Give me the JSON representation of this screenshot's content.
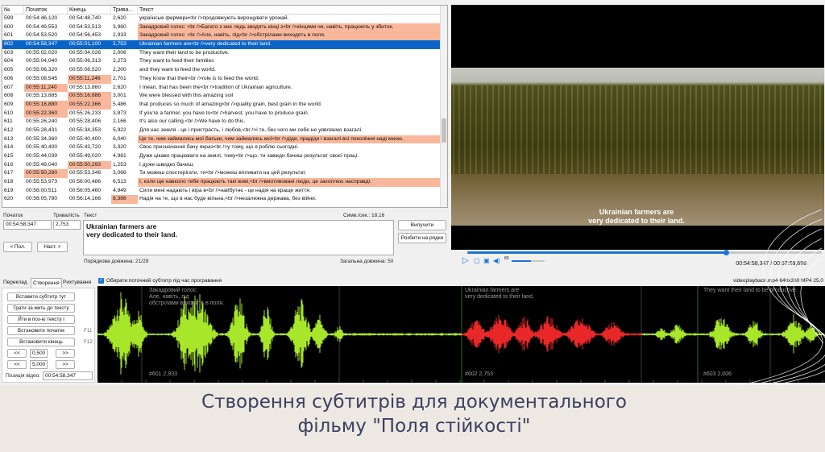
{
  "grid": {
    "headers": [
      "№",
      "Початок",
      "Кінець",
      "Трива...",
      "Текст"
    ],
    "rows": [
      {
        "n": "599",
        "start": "00:54:46,120",
        "end": "00:54:48,740",
        "dur": "2,620",
        "text": "українські фермери<br />продовжують вирощувати урожай.",
        "warn": false,
        "end_hl": false,
        "start_hl": false,
        "dur_hl": false,
        "sel": false
      },
      {
        "n": "600",
        "start": "00:54:49,553",
        "end": "00:54:53,513",
        "dur": "3,960",
        "text": "Закадровий голос: <br />Багато з них ледь зводять кінці з<br />кінцями чи, навіть, працюють у збиток.",
        "warn": true,
        "end_hl": false,
        "start_hl": false,
        "dur_hl": false,
        "sel": false
      },
      {
        "n": "601",
        "start": "00:54:53,520",
        "end": "00:54:56,453",
        "dur": "2,933",
        "text": "Закадровий голос: <br />Але, навіть, під<br />обстрілами виходять в поля.",
        "warn": true,
        "end_hl": false,
        "start_hl": false,
        "dur_hl": false,
        "sel": false
      },
      {
        "n": "602",
        "start": "00:54:58,347",
        "end": "00:55:01,100",
        "dur": "2,753",
        "text": "Ukrainian farmers are<br />very dedicated to their land.",
        "warn": false,
        "end_hl": false,
        "start_hl": false,
        "dur_hl": false,
        "sel": true
      },
      {
        "n": "603",
        "start": "00:55:02,020",
        "end": "00:55:04,026",
        "dur": "2,006",
        "text": "They want their land to be productive.",
        "warn": false,
        "end_hl": false,
        "start_hl": false,
        "dur_hl": false,
        "sel": false
      },
      {
        "n": "604",
        "start": "00:55:04,040",
        "end": "00:55:06,313",
        "dur": "2,273",
        "text": "They want to feed their families",
        "warn": false,
        "end_hl": false,
        "start_hl": false,
        "dur_hl": false,
        "sel": false
      },
      {
        "n": "605",
        "start": "00:55:06,320",
        "end": "00:55:08,520",
        "dur": "2,200",
        "text": "and they want to feed the world.",
        "warn": false,
        "end_hl": false,
        "start_hl": false,
        "dur_hl": false,
        "sel": false
      },
      {
        "n": "606",
        "start": "00:55:08,545",
        "end": "00:55:11,246",
        "dur": "2,701",
        "text": "They know that their<br />role is to feed the world.",
        "warn": false,
        "end_hl": true,
        "start_hl": false,
        "dur_hl": false,
        "sel": false
      },
      {
        "n": "607",
        "start": "00:55:11,240",
        "end": "00:55:13,860",
        "dur": "2,620",
        "text": "I mean, that has been the<br />tradition of Ukrainian agriculture.",
        "warn": false,
        "end_hl": false,
        "start_hl": true,
        "dur_hl": false,
        "sel": false
      },
      {
        "n": "608",
        "start": "00:55:13,885",
        "end": "00:55:16,886",
        "dur": "3,001",
        "text": "We were blessed with this amazing soil",
        "warn": false,
        "end_hl": true,
        "start_hl": false,
        "dur_hl": false,
        "sel": false
      },
      {
        "n": "609",
        "start": "00:55:16,880",
        "end": "00:55:22,366",
        "dur": "5,486",
        "text": "that produces so much of amazing<br />quality grain, best grain in the world.",
        "warn": false,
        "end_hl": true,
        "start_hl": true,
        "dur_hl": false,
        "sel": false
      },
      {
        "n": "610",
        "start": "00:55:22,360",
        "end": "00:55:26,233",
        "dur": "3,873",
        "text": "If you're a farmer, you have to<br />harvest, you have to produce grain.",
        "warn": false,
        "end_hl": false,
        "start_hl": true,
        "dur_hl": false,
        "sel": false
      },
      {
        "n": "611",
        "start": "00:55:26,240",
        "end": "00:55:28,406",
        "dur": "2,166",
        "text": "It's also our calling.<br />We have to do this.",
        "warn": false,
        "end_hl": false,
        "start_hl": false,
        "dur_hl": false,
        "sel": false
      },
      {
        "n": "612",
        "start": "00:55:28,431",
        "end": "00:55:34,353",
        "dur": "5,922",
        "text": "Для нас земля - це і пристрасть, і любов,<br />і те, без чого ми себе не уявляємо взагалі.",
        "warn": false,
        "end_hl": false,
        "start_hl": false,
        "dur_hl": false,
        "sel": false
      },
      {
        "n": "613",
        "start": "00:55:34,360",
        "end": "00:55:40,400",
        "dur": "6,040",
        "text": "Це те, чим займались мої батьки, чим займались мої<br />діди, прадіди і взагалі всі покоління наді мною.",
        "warn": true,
        "end_hl": false,
        "start_hl": false,
        "dur_hl": false,
        "sel": false
      },
      {
        "n": "614",
        "start": "00:55:40,400",
        "end": "00:55:43,720",
        "dur": "3,320",
        "text": "Своє призначення бачу якраз<br />у тому, що я роблю сьогодні.",
        "warn": false,
        "end_hl": false,
        "start_hl": false,
        "dur_hl": false,
        "sel": false
      },
      {
        "n": "615",
        "start": "00:55:44,039",
        "end": "00:55:49,020",
        "dur": "4,981",
        "text": "Дуже цікаво працювати на землі, тому<br />що, ти завжди бачиш результат своєї праці.",
        "warn": false,
        "end_hl": false,
        "start_hl": false,
        "dur_hl": false,
        "sel": false
      },
      {
        "n": "616",
        "start": "00:55:49,040",
        "end": "00:55:50,293",
        "dur": "1,253",
        "text": "І дуже швидко бачиш.",
        "warn": false,
        "end_hl": true,
        "start_hl": false,
        "dur_hl": false,
        "sel": false
      },
      {
        "n": "617",
        "start": "00:55:50,280",
        "end": "00:55:53,346",
        "dur": "3,066",
        "text": "Ти можеш спостерігати, ти<br />можеш впливати на цей результат.",
        "warn": false,
        "end_hl": false,
        "start_hl": true,
        "dur_hl": false,
        "sel": false
      },
      {
        "n": "618",
        "start": "00:55:53,973",
        "end": "00:56:00,486",
        "dur": "6,513",
        "text": "І, коли ще навколо тебе працюють такі живі,<br />вмотивовані люди, це захоплює насправді.",
        "warn": true,
        "end_hl": false,
        "start_hl": false,
        "dur_hl": false,
        "sel": false
      },
      {
        "n": "619",
        "start": "00:56:00,511",
        "end": "00:56:05,460",
        "dur": "4,949",
        "text": "Сили мені надають і віра в<br />найбутнє - це надія на краще життя.",
        "warn": false,
        "end_hl": false,
        "start_hl": false,
        "dur_hl": false,
        "sel": false
      },
      {
        "n": "620",
        "start": "00:56:05,780",
        "end": "00:56:14,166",
        "dur": "8,386",
        "text": "Надія на те, що в нас буде вільна,<br />незалежна держава, без війни.",
        "warn": false,
        "end_hl": false,
        "start_hl": false,
        "dur_hl": true,
        "sel": false
      }
    ]
  },
  "editor": {
    "start_label": "Початок",
    "duration_label": "Тривалість",
    "text_label": "Текст",
    "cps_label": "Симв./сек.: 18,16",
    "start_value": "00:54:58,347",
    "duration_value": "2,753",
    "text_line1": "Ukrainian farmers are",
    "text_line2": "very dedicated to their land.",
    "prev_button": "< Пол.",
    "next_button": "Наст. >",
    "unbreak_button": "Вилучити",
    "split_button": "Розбити на рядки",
    "line_lengths": "Порядкова довжина: 21/29",
    "total_length": "Загальна довжина: 50"
  },
  "video": {
    "subtitle_line1": "Ukrainian farmers are",
    "subtitle_line2": "very dedicated to their land.",
    "volume_label": "80",
    "timecode": "00:54:58,347 / 00:57:59,696",
    "progress": 0.73
  },
  "tabs": [
    "Переклад",
    "Створення",
    "Рихтування"
  ],
  "create_panel": {
    "insert_button": "Вставити субтитр тут",
    "play_second_button": "Грати за мить до тексту",
    "go_to_button": "Йти в поз-ю тексту і",
    "set_start_button": "Встановити початок",
    "set_start_key": "F11",
    "set_end_button": "Встановити кінець",
    "set_end_key": "F12",
    "step1": "0,500",
    "step2": "5,000",
    "back": "<<",
    "forward": ">>",
    "video_pos_label": "Позиція відео:",
    "video_pos_value": "00:54:58,347"
  },
  "waveform": {
    "checkbox_label": "Обирати поточний субтитр під час програвання",
    "file_info": "videoplayback.mp4 640x360 MP4 25,0",
    "seg_left_text_1": "Закадровий голос:",
    "seg_left_text_2": "Але, навіть, під",
    "seg_left_text_3": "обстрілами виходять в поля.",
    "seg_mid_text_1": "Ukrainian farmers are",
    "seg_mid_text_2": "very dedicated to their land.",
    "seg_right_text": "They want their land to be productive.",
    "label_601": "#601  2,933",
    "label_602": "#602  2,753",
    "label_603": "#603  2,006"
  },
  "caption": {
    "line1": "Створення субтитрів для документального",
    "line2": "фільму \"Поля стійкості\""
  },
  "colors": {
    "accent": "#0a64c8",
    "warning_row": "#f9b79b",
    "wave_green": "#a8e62a",
    "wave_red": "#e82828",
    "caption": "#3a4060"
  }
}
